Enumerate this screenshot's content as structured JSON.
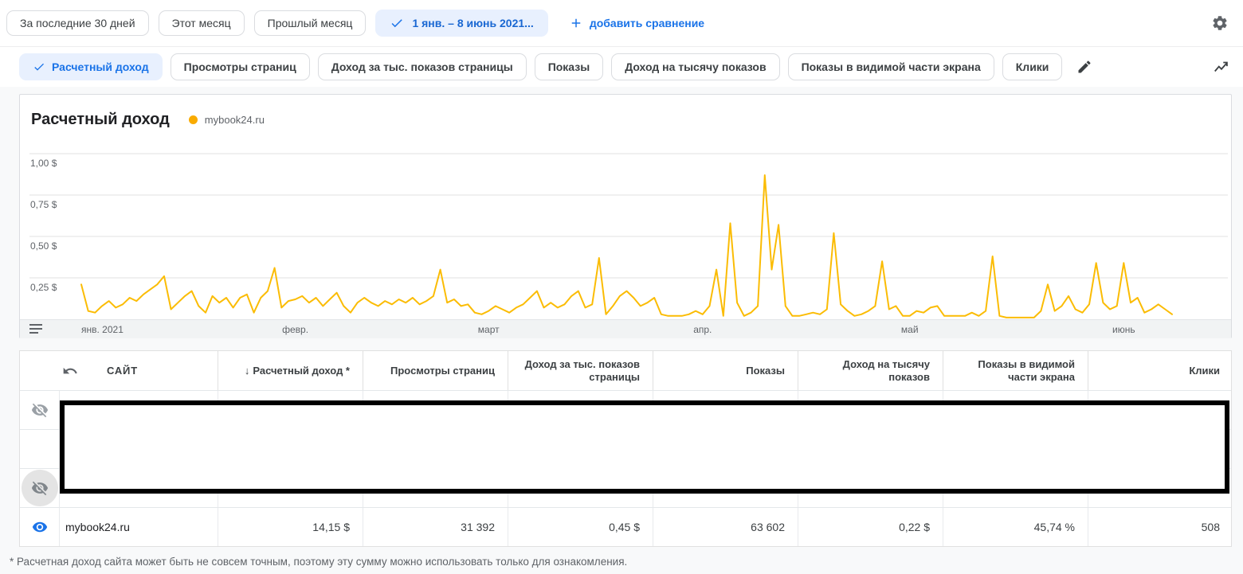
{
  "date_bar": {
    "preset_buttons": [
      "За последние 30 дней",
      "Этот месяц",
      "Прошлый месяц"
    ],
    "selected_range_label": "1 янв. – 8 июнь 2021...",
    "add_comparison_label": "добавить сравнение"
  },
  "metrics_bar": {
    "chips": [
      {
        "label": "Расчетный доход",
        "selected": true
      },
      {
        "label": "Просмотры страниц",
        "selected": false
      },
      {
        "label": "Доход за тыс. показов страницы",
        "selected": false
      },
      {
        "label": "Показы",
        "selected": false
      },
      {
        "label": "Доход на тысячу показов",
        "selected": false
      },
      {
        "label": "Показы в видимой части экрана",
        "selected": false
      },
      {
        "label": "Клики",
        "selected": false
      }
    ]
  },
  "chart_card": {
    "title": "Расчетный доход",
    "legend_label": "mybook24.ru"
  },
  "chart_data": {
    "type": "line",
    "title": "Расчетный доход",
    "series_name": "mybook24.ru",
    "unit": "USD",
    "date_range": "1 янв. 2021 – 8 июнь 2021",
    "ylim": [
      0,
      1.35
    ],
    "grid": true,
    "legend_position": "top-left",
    "y_ticks": [
      {
        "value": 0.25,
        "label": "0,25 $"
      },
      {
        "value": 0.5,
        "label": "0,50 $"
      },
      {
        "value": 0.75,
        "label": "0,75 $"
      },
      {
        "value": 1.0,
        "label": "1,00 $"
      }
    ],
    "x_ticks": [
      {
        "label": "янв. 2021",
        "day": 0
      },
      {
        "label": "февр.",
        "day": 31
      },
      {
        "label": "март",
        "day": 59
      },
      {
        "label": "апр.",
        "day": 90
      },
      {
        "label": "май",
        "day": 120
      },
      {
        "label": "июнь",
        "day": 151
      }
    ],
    "values": [
      0.21,
      0.05,
      0.04,
      0.08,
      0.11,
      0.07,
      0.09,
      0.13,
      0.11,
      0.15,
      0.18,
      0.21,
      0.26,
      0.06,
      0.1,
      0.14,
      0.17,
      0.08,
      0.04,
      0.14,
      0.1,
      0.13,
      0.07,
      0.13,
      0.15,
      0.04,
      0.13,
      0.17,
      0.31,
      0.07,
      0.11,
      0.12,
      0.14,
      0.1,
      0.13,
      0.08,
      0.12,
      0.16,
      0.08,
      0.04,
      0.1,
      0.13,
      0.1,
      0.08,
      0.11,
      0.09,
      0.12,
      0.1,
      0.13,
      0.09,
      0.11,
      0.14,
      0.3,
      0.1,
      0.12,
      0.08,
      0.09,
      0.04,
      0.03,
      0.05,
      0.08,
      0.06,
      0.04,
      0.07,
      0.09,
      0.13,
      0.17,
      0.07,
      0.1,
      0.07,
      0.09,
      0.14,
      0.17,
      0.07,
      0.09,
      0.37,
      0.03,
      0.08,
      0.14,
      0.17,
      0.13,
      0.08,
      0.1,
      0.13,
      0.03,
      0.02,
      0.02,
      0.02,
      0.03,
      0.05,
      0.03,
      0.08,
      0.3,
      0.02,
      0.58,
      0.1,
      0.02,
      0.04,
      0.08,
      0.87,
      0.3,
      0.57,
      0.08,
      0.02,
      0.02,
      0.03,
      0.04,
      0.03,
      0.06,
      0.52,
      0.09,
      0.05,
      0.02,
      0.03,
      0.05,
      0.08,
      0.35,
      0.06,
      0.08,
      0.02,
      0.02,
      0.05,
      0.04,
      0.07,
      0.08,
      0.02,
      0.02,
      0.02,
      0.02,
      0.04,
      0.02,
      0.05,
      0.38,
      0.02,
      0.01,
      0.01,
      0.01,
      0.01,
      0.01,
      0.05,
      0.21,
      0.05,
      0.08,
      0.14,
      0.06,
      0.04,
      0.09,
      0.34,
      0.1,
      0.06,
      0.08,
      0.34,
      0.1,
      0.13,
      0.04,
      0.06,
      0.09,
      0.06,
      0.03
    ]
  },
  "table": {
    "columns": [
      "САЙТ",
      "Расчетный доход *",
      "Просмотры страниц",
      "Доход за тыс. показов страницы",
      "Показы",
      "Доход на тысячу показов",
      "Показы в видимой части экрана",
      "Клики"
    ],
    "sort": {
      "column": "Расчетный доход *",
      "direction": "desc",
      "arrow": "↓"
    },
    "rows": [
      {
        "site": "mybook24.ru",
        "values": [
          "14,15 $",
          "31 392",
          "0,45 $",
          "63 602",
          "0,22 $",
          "45,74 %",
          "508"
        ]
      }
    ]
  },
  "footnote": "* Расчетная доход сайта может быть не совсем точным, поэтому эту сумму можно использовать только для ознакомления.",
  "colors": {
    "accent_blue": "#1a73e8",
    "selected_chip_bg": "#e8f0fe",
    "chart_line": "#fbbc04",
    "legend_dot": "#f9ab00",
    "grid_line": "#e0e0e0",
    "axis_strip_bg": "#f1f3f4",
    "muted_text": "#5f6368",
    "redaction_border": "#000000"
  }
}
